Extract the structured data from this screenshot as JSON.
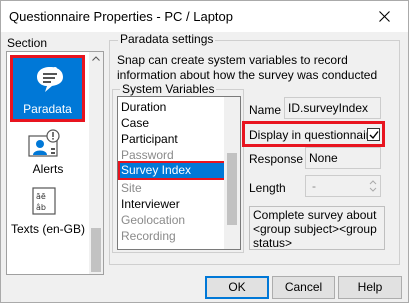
{
  "window": {
    "title": "Questionnaire Properties - PC / Laptop"
  },
  "sidebar": {
    "heading": "Section",
    "items": [
      {
        "label": "Paradata",
        "icon": "paradata-icon",
        "selected": true
      },
      {
        "label": "Alerts",
        "icon": "alerts-icon",
        "selected": false
      },
      {
        "label": "Texts (en-GB)",
        "icon": "texts-icon",
        "selected": false
      }
    ]
  },
  "paradata": {
    "group_title": "Paradata settings",
    "description": "Snap can create system variables to record information about how the survey was conducted",
    "system_variables": {
      "group_title": "System Variables",
      "items": [
        {
          "label": "Duration",
          "enabled": true
        },
        {
          "label": "Case",
          "enabled": true
        },
        {
          "label": "Participant",
          "enabled": true
        },
        {
          "label": "Password",
          "enabled": false
        },
        {
          "label": "Survey Index",
          "enabled": true,
          "selected": true
        },
        {
          "label": "Site",
          "enabled": false
        },
        {
          "label": "Interviewer",
          "enabled": true
        },
        {
          "label": "Geolocation",
          "enabled": false
        },
        {
          "label": "Recording",
          "enabled": false
        }
      ]
    },
    "name_label": "Name",
    "name_value": "ID.surveyIndex",
    "display_label": "Display in questionnaire",
    "display_checked": true,
    "response_label": "Response",
    "response_value": "None",
    "length_label": "Length",
    "length_value": "-",
    "footer_text": "Complete survey about <group subject><group status>"
  },
  "buttons": {
    "ok": "OK",
    "cancel": "Cancel",
    "help": "Help"
  },
  "colors": {
    "selection": "#0078d7",
    "highlight_box": "#e8141f"
  }
}
